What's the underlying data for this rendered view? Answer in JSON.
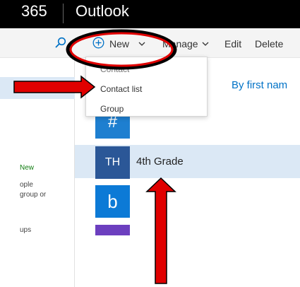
{
  "app": {
    "product": "365",
    "name": "Outlook"
  },
  "toolbar": {
    "new_label": "New",
    "manage_label": "Manage",
    "edit_label": "Edit",
    "delete_label": "Delete"
  },
  "new_menu": {
    "items": [
      "Contact",
      "Contact list",
      "Group"
    ]
  },
  "sidebar": {
    "new_label": "New",
    "people_text_1": "ople",
    "people_text_2": "group or",
    "groups_text": "ups"
  },
  "list": {
    "sort_label": "By first nam",
    "rows": [
      {
        "initials": "#",
        "name": ""
      },
      {
        "initials": "TH",
        "name": "4th Grade"
      },
      {
        "initials": "b",
        "name": ""
      }
    ]
  },
  "colors": {
    "topbar": "#000000",
    "accent": "#0072c6",
    "selected_row": "#dbe8f5",
    "tile_blue": "#1e7fd0",
    "tile_th": "#2b5797",
    "tile_purple": "#6c3fbf",
    "annotation_red": "#e00000"
  },
  "icons": {
    "search": "search-icon",
    "new": "plus-circle-icon",
    "dropdown": "chevron-down-icon"
  }
}
